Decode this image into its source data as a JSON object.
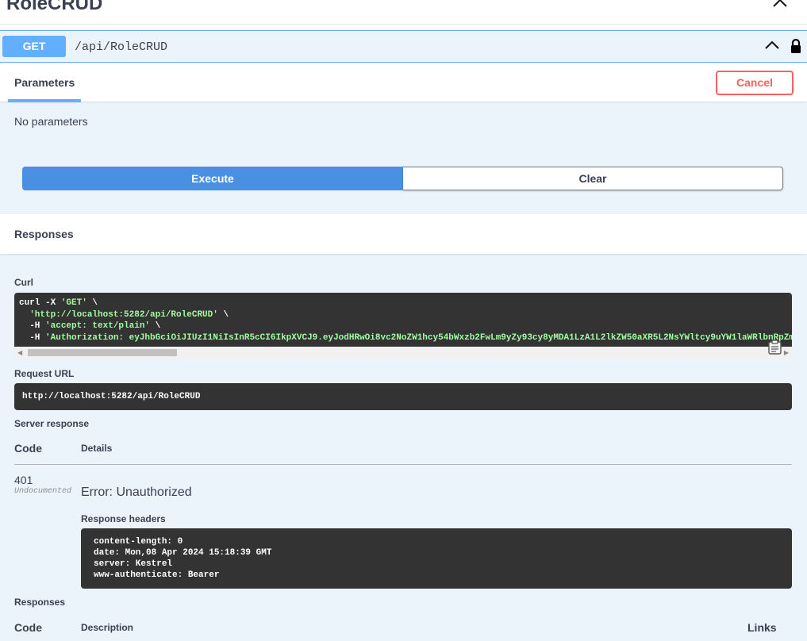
{
  "tag": {
    "title": "RoleCRUD"
  },
  "operation": {
    "method": "GET",
    "path": "/api/RoleCRUD"
  },
  "parameters": {
    "tab_label": "Parameters",
    "cancel_label": "Cancel",
    "empty_text": "No parameters",
    "execute_label": "Execute",
    "clear_label": "Clear"
  },
  "responses_section": {
    "title": "Responses"
  },
  "curl": {
    "label": "Curl",
    "line1_cmd": "curl -X ",
    "line1_method": "'GET'",
    "line1_tail": " \\",
    "line2_url": "'http://localhost:5282/api/RoleCRUD'",
    "line2_tail": " \\",
    "line3_flag": "  -H ",
    "line3_val": "'accept: text/plain'",
    "line3_tail": " \\",
    "line4_flag": "  -H ",
    "line4_val": "'Authorization: eyJhbGciOiJIUzI1NiIsInR5cCI6IkpXVCJ9.eyJodHRwOi8vc2NoZW1hcy54bWxzb2FwLm9yZy93cy8yMDA1LzA1L2lkZW50aXR5L2NsYWltcy9uYW1laWRlbnRpZm"
  },
  "request_url": {
    "label": "Request URL",
    "value": "http://localhost:5282/api/RoleCRUD"
  },
  "server_response": {
    "label": "Server response",
    "col_code": "Code",
    "col_details": "Details",
    "code": "401",
    "undocumented": "Undocumented",
    "error": "Error: Unauthorized",
    "headers_label": "Response headers",
    "headers": [
      "content-length: 0",
      "date: Mon,08 Apr 2024 15:18:39 GMT",
      "server: Kestrel",
      "www-authenticate: Bearer"
    ]
  },
  "responses_table": {
    "label": "Responses",
    "col_code": "Code",
    "col_description": "Description",
    "col_links": "Links"
  },
  "colors": {
    "get_accent": "#61affe",
    "execute": "#4990e2",
    "cancel": "#ff6060",
    "code_bg": "#333333",
    "opblock_bg": "#ebf3fb"
  }
}
